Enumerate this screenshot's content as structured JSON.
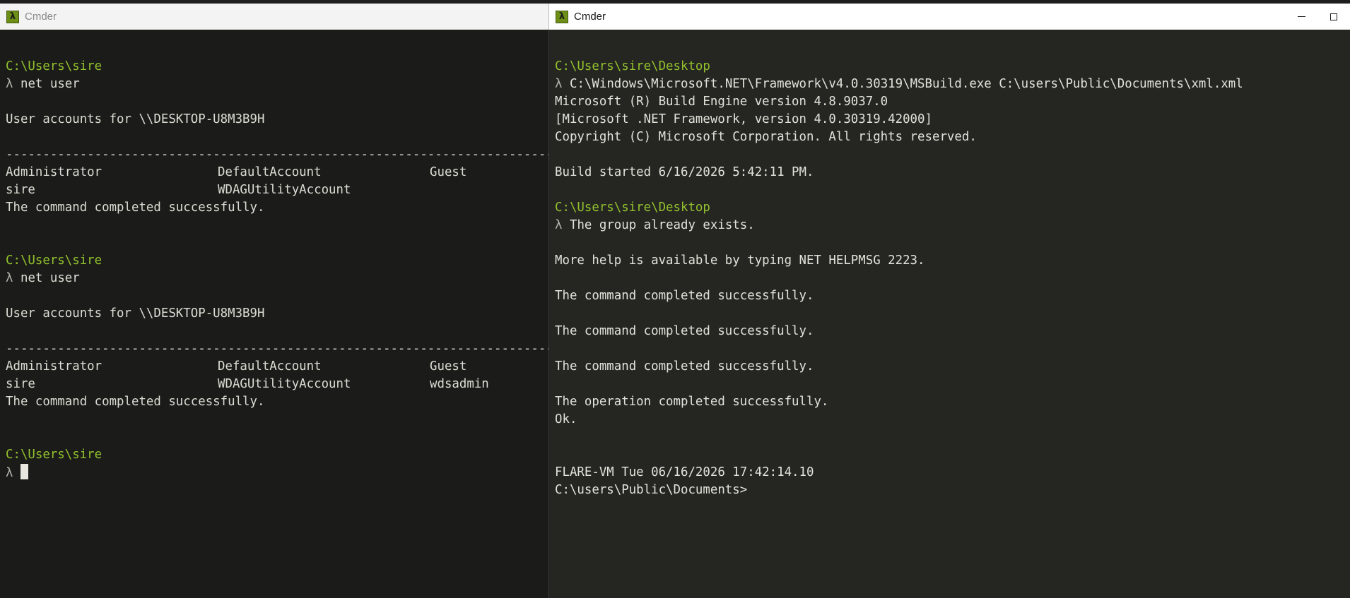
{
  "left_window": {
    "title": "Cmder",
    "session1": {
      "prompt_path": "C:\\Users\\sire",
      "prompt_symbol": "λ",
      "command": "net user",
      "header": "User accounts for \\\\DESKTOP-U8M3B9H",
      "separator": "-------------------------------------------------------------------------------",
      "accounts_row1": [
        "Administrator",
        "DefaultAccount",
        "Guest"
      ],
      "accounts_row2": [
        "sire",
        "WDAGUtilityAccount",
        ""
      ],
      "status": "The command completed successfully."
    },
    "session2": {
      "prompt_path": "C:\\Users\\sire",
      "prompt_symbol": "λ",
      "command": "net user",
      "header": "User accounts for \\\\DESKTOP-U8M3B9H",
      "separator": "-------------------------------------------------------------------------------",
      "accounts_row1": [
        "Administrator",
        "DefaultAccount",
        "Guest"
      ],
      "accounts_row2": [
        "sire",
        "WDAGUtilityAccount",
        "wdsadmin"
      ],
      "status": "The command completed successfully."
    },
    "final_prompt": {
      "prompt_path": "C:\\Users\\sire",
      "prompt_symbol": "λ"
    }
  },
  "right_window": {
    "title": "Cmder",
    "block1": {
      "prompt_path": "C:\\Users\\sire\\Desktop",
      "prompt_symbol": "λ",
      "command": "C:\\Windows\\Microsoft.NET\\Framework\\v4.0.30319\\MSBuild.exe C:\\users\\Public\\Documents\\xml.xml",
      "output": [
        "Microsoft (R) Build Engine version 4.8.9037.0",
        "[Microsoft .NET Framework, version 4.0.30319.42000]",
        "Copyright (C) Microsoft Corporation. All rights reserved.",
        "",
        "Build started 6/16/2026 5:42:11 PM."
      ]
    },
    "block2": {
      "prompt_path": "C:\\Users\\sire\\Desktop",
      "prompt_symbol": "λ",
      "first_line": "The group already exists.",
      "output": [
        "",
        "More help is available by typing NET HELPMSG 2223.",
        "",
        "The command completed successfully.",
        "",
        "The command completed successfully.",
        "",
        "The command completed successfully.",
        "",
        "The operation completed successfully.",
        "Ok.",
        "",
        "",
        "FLARE-VM Tue 06/16/2026 17:42:14.10",
        "C:\\users\\Public\\Documents>"
      ]
    }
  },
  "colors": {
    "prompt_green": "#92c12d",
    "console_bg_left": "#1b1c19",
    "console_bg_right": "#252622",
    "icon_green": "#6d8e17"
  },
  "icons": {
    "app_icon": "lambda-icon",
    "minimize": "minimize-icon",
    "maximize": "maximize-icon"
  }
}
